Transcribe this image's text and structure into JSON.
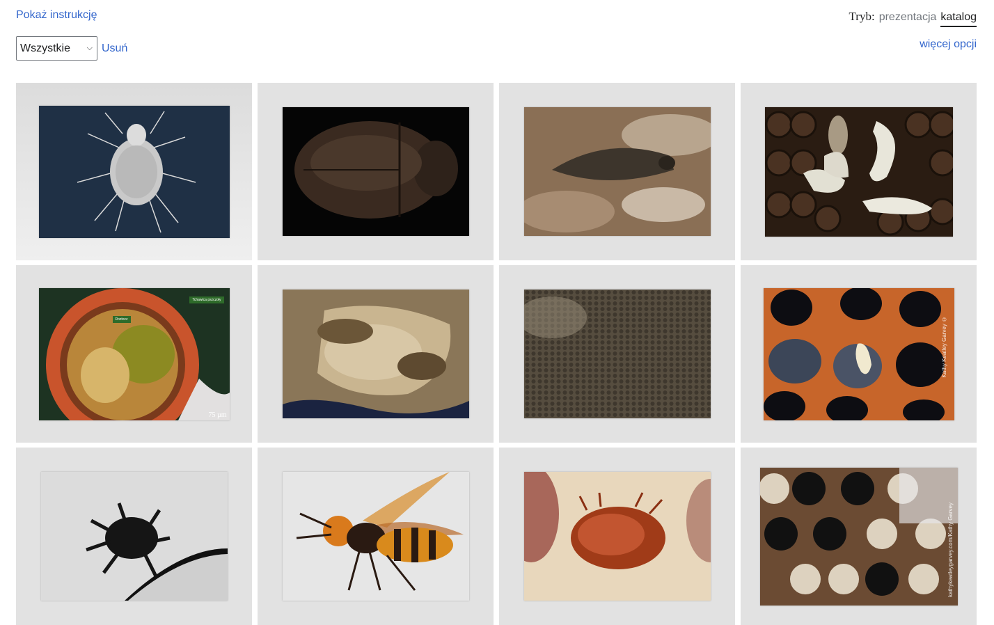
{
  "header": {
    "show_instructions": "Pokaż instrukcję",
    "mode_label": "Tryb:",
    "mode_presentation": "prezentacja",
    "mode_catalog": "katalog"
  },
  "filter": {
    "selected": "Wszystkie",
    "remove_label": "Usuń"
  },
  "more_options": "więcej opcji",
  "gallery": {
    "images": [
      {
        "icon": "mite-sem-image"
      },
      {
        "icon": "beetle-image"
      },
      {
        "icon": "wax-moth-image"
      },
      {
        "icon": "bee-larvae-image"
      },
      {
        "icon": "mite-in-trachea-image",
        "tag_top": "Tchawica pszczoły",
        "tag_mid": "Roztocz",
        "scale": "75 µm"
      },
      {
        "icon": "bee-swarm-comb-image"
      },
      {
        "icon": "empty-honeycomb-image"
      },
      {
        "icon": "pupa-in-cell-image",
        "watermark": "Kathy Keatley Garvey ©"
      },
      {
        "icon": "mite-silhouette-image"
      },
      {
        "icon": "hornet-image"
      },
      {
        "icon": "varroa-mite-image"
      },
      {
        "icon": "damaged-comb-image",
        "watermark": "kathykeatleygarvey.com/Kathy Garvey"
      }
    ]
  }
}
